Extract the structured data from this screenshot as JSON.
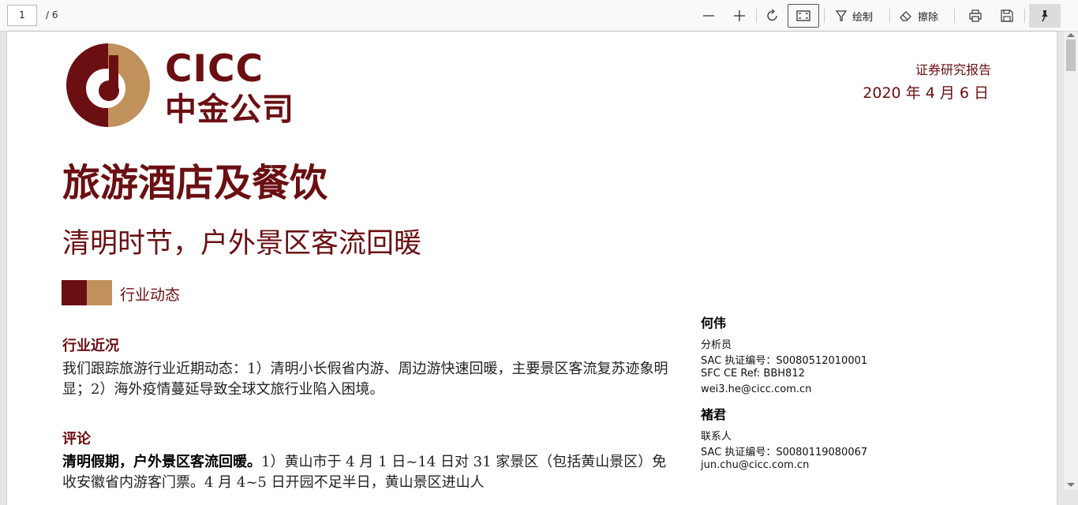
{
  "toolbar": {
    "page_current": "1",
    "page_total": "/ 6",
    "zoom_out_icon": "minus-icon",
    "zoom_in_icon": "plus-icon",
    "rotate_icon": "rotate-icon",
    "fit_icon": "fit-page-icon",
    "draw_label": "绘制",
    "erase_label": "擦除",
    "print_icon": "printer-icon",
    "save_icon": "save-icon",
    "pin_icon": "pin-icon"
  },
  "document": {
    "logo_en": "CICC",
    "logo_cn": "中金公司",
    "report_type": "证券研究报告",
    "date": "2020 年 4 月 6 日",
    "title": "旅游酒店及餐饮",
    "subtitle": "清明时节，户外景区客流回暖",
    "tag": "行业动态",
    "section1_title": "行业近况",
    "section1_body": "我们跟踪旅游行业近期动态：1）清明小长假省内游、周边游快速回暖，主要景区客流复苏迹象明显；2）海外疫情蔓延导致全球文旅行业陷入困境。",
    "section2_title": "评论",
    "section2_bold": "清明假期，户外景区客流回暖。",
    "section2_body": "1）黄山市于 4 月 1 日~14 日对 31 家景区（包括黄山景区）免收安徽省内游客门票。4 月 4~5 日开园不足半日，黄山景区进山人"
  },
  "analysts": [
    {
      "name": "何伟",
      "role": "分析员",
      "sac": "SAC  执证编号：S0080512010001",
      "sfc": "SFC CE Ref:   BBH812",
      "email": "wei3.he@cicc.com.cn"
    },
    {
      "name": "褚君",
      "role": "联系人",
      "sac": "SAC  执证编号：S0080119080067",
      "email": "jun.chu@cicc.com.cn"
    }
  ],
  "colors": {
    "brand_red": "#6b0f12",
    "brand_gold": "#c0915a"
  }
}
